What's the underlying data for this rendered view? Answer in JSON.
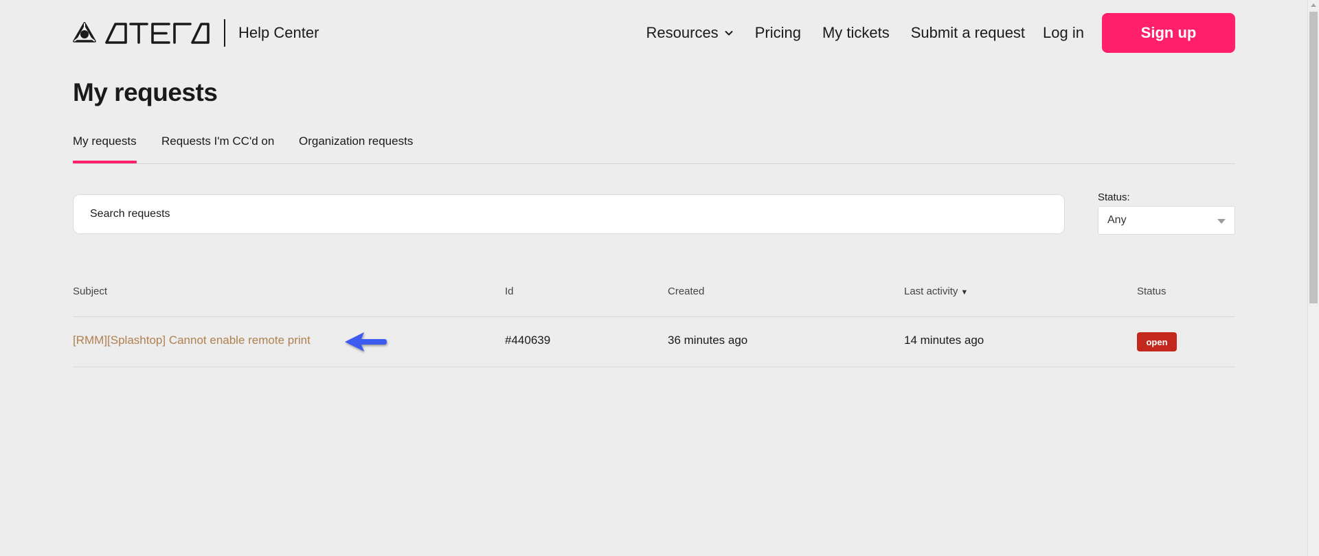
{
  "header": {
    "logo_alt": "ATERA",
    "help_center": "Help Center",
    "nav": {
      "resources": "Resources",
      "pricing": "Pricing",
      "my_tickets": "My tickets",
      "submit_request": "Submit a request",
      "login": "Log in",
      "signup": "Sign up"
    }
  },
  "page_title": "My requests",
  "tabs": [
    {
      "label": "My requests",
      "active": true
    },
    {
      "label": "Requests I'm CC'd on",
      "active": false
    },
    {
      "label": "Organization requests",
      "active": false
    }
  ],
  "search": {
    "placeholder": "Search requests"
  },
  "status_filter": {
    "label": "Status:",
    "selected": "Any"
  },
  "table": {
    "headers": {
      "subject": "Subject",
      "id": "Id",
      "created": "Created",
      "last_activity": "Last activity",
      "status": "Status"
    },
    "rows": [
      {
        "subject": "[RMM][Splashtop] Cannot enable remote print",
        "id": "#440639",
        "created": "36 minutes ago",
        "last_activity": "14 minutes ago",
        "status": "open"
      }
    ]
  },
  "colors": {
    "accent": "#ff1f6a",
    "link": "#b08050",
    "status_open": "#c4281c",
    "annotation_arrow": "#3d5af1"
  },
  "icons": [
    "atera-logo-icon",
    "chevron-down-icon",
    "sort-desc-icon",
    "dropdown-caret-icon",
    "pointer-arrow-icon"
  ]
}
